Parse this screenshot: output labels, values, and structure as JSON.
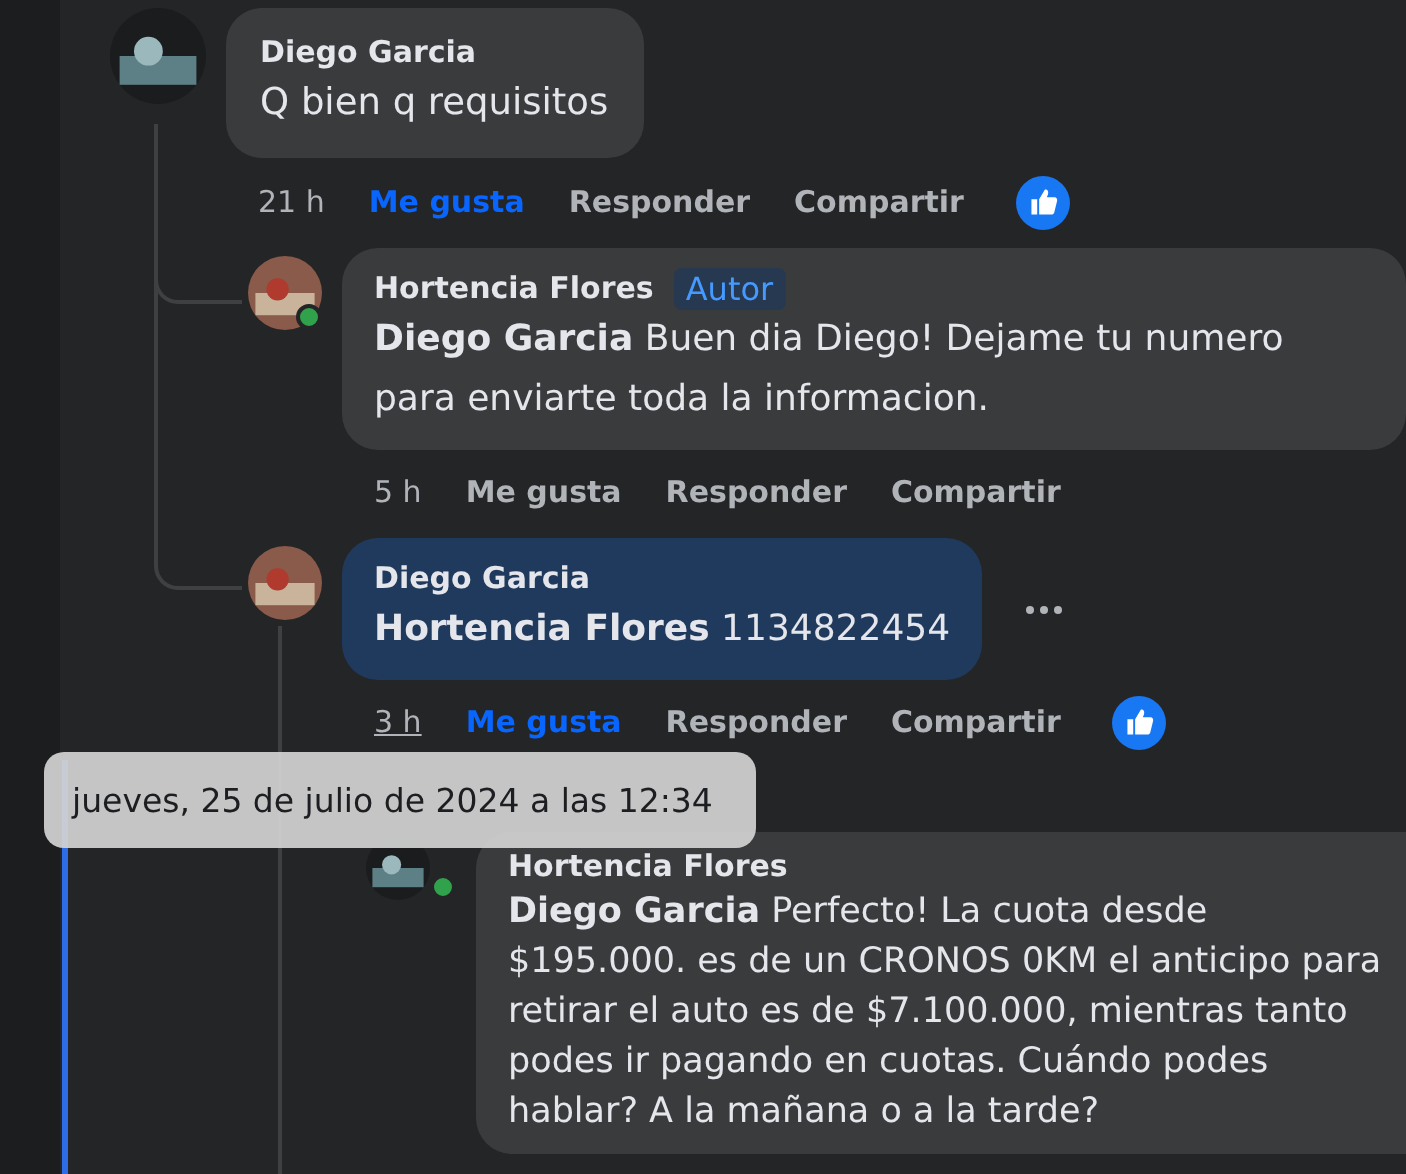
{
  "comments": [
    {
      "author": "Diego Garcia",
      "text": "Q bien q requisitos",
      "online": false,
      "highlighted": false,
      "time": "21 h",
      "time_underlined": false,
      "liked": true,
      "reaction": true,
      "more_menu": false,
      "actions": [
        "Me gusta",
        "Responder",
        "Compartir"
      ],
      "children": [
        {
          "author": "Hortencia Flores",
          "badge": "Autor",
          "text": "**Diego Garcia** Buen dia Diego! Dejame tu numero para enviarte toda la informacion.",
          "online": true,
          "highlighted": false,
          "time": "5 h",
          "time_underlined": false,
          "liked": false,
          "reaction": false,
          "more_menu": false,
          "actions": [
            "Me gusta",
            "Responder",
            "Compartir"
          ]
        },
        {
          "author": "Diego Garcia",
          "text": "**Hortencia Flores** 1134822454",
          "online": false,
          "highlighted": true,
          "time": "3 h",
          "time_underlined": true,
          "liked": true,
          "reaction": true,
          "more_menu": true,
          "actions": [
            "Me gusta",
            "Responder",
            "Compartir"
          ],
          "children": [
            {
              "author": "Hortencia Flores",
              "text": "**Diego Garcia** Perfecto! La cuota desde $195.000. es de un CRONOS 0KM el anticipo para retirar el auto es de $7.100.000, mientras tanto podes ir pagando en cuotas. Cuándo podes hablar? A la mañana o a la tarde?",
              "online": true,
              "highlighted": false
            }
          ]
        }
      ]
    }
  ],
  "tooltip": {
    "text": "jueves, 25 de julio de 2024 a las 12:34"
  }
}
